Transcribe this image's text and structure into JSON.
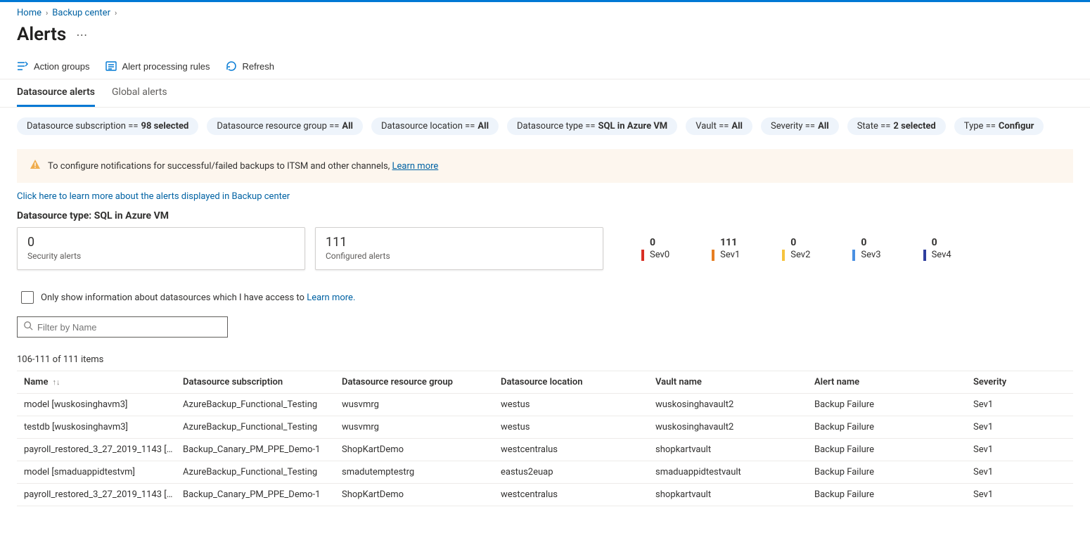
{
  "breadcrumb": {
    "home": "Home",
    "center": "Backup center"
  },
  "title": "Alerts",
  "toolbar": {
    "action_groups": "Action groups",
    "alert_rules": "Alert processing rules",
    "refresh": "Refresh"
  },
  "tabs": {
    "datasource": "Datasource alerts",
    "global": "Global alerts"
  },
  "filters": [
    {
      "label": "Datasource subscription == ",
      "value": "98 selected"
    },
    {
      "label": "Datasource resource group == ",
      "value": "All"
    },
    {
      "label": "Datasource location == ",
      "value": "All"
    },
    {
      "label": "Datasource type == ",
      "value": "SQL in Azure VM"
    },
    {
      "label": "Vault == ",
      "value": "All"
    },
    {
      "label": "Severity == ",
      "value": "All"
    },
    {
      "label": "State == ",
      "value": "2 selected"
    },
    {
      "label": "Type == ",
      "value": "Configur"
    }
  ],
  "banner": {
    "text": "To configure notifications for successful/failed backups to ITSM and other channels, ",
    "link": "Learn more"
  },
  "info_link": "Click here to learn more about the alerts displayed in Backup center",
  "section_label": "Datasource type: SQL in Azure VM",
  "cards": {
    "security": {
      "num": "0",
      "label": "Security alerts"
    },
    "configured": {
      "num": "111",
      "label": "Configured alerts"
    }
  },
  "severities": [
    {
      "num": "0",
      "label": "Sev0",
      "color": "#d93025"
    },
    {
      "num": "111",
      "label": "Sev1",
      "color": "#e67e22"
    },
    {
      "num": "0",
      "label": "Sev2",
      "color": "#f6c33d"
    },
    {
      "num": "0",
      "label": "Sev3",
      "color": "#4a90e2"
    },
    {
      "num": "0",
      "label": "Sev4",
      "color": "#2f3e9e"
    }
  ],
  "cb_line": {
    "text": "Only show information about datasources which I have access to ",
    "link": "Learn more."
  },
  "filter_placeholder": "Filter by Name",
  "count_text": "106-111 of 111 items",
  "columns": [
    "Name",
    "Datasource subscription",
    "Datasource resource group",
    "Datasource location",
    "Vault name",
    "Alert name",
    "Severity"
  ],
  "rows": [
    {
      "name": "model [wuskosinghavm3]",
      "sub": "AzureBackup_Functional_Testing",
      "rg": "wusvmrg",
      "loc": "westus",
      "vault": "wuskosinghavault2",
      "alert": "Backup Failure",
      "sev": "Sev1"
    },
    {
      "name": "testdb [wuskosinghavm3]",
      "sub": "AzureBackup_Functional_Testing",
      "rg": "wusvmrg",
      "loc": "westus",
      "vault": "wuskosinghavault2",
      "alert": "Backup Failure",
      "sev": "Sev1"
    },
    {
      "name": "payroll_restored_3_27_2019_1143 [s...",
      "sub": "Backup_Canary_PM_PPE_Demo-1",
      "rg": "ShopKartDemo",
      "loc": "westcentralus",
      "vault": "shopkartvault",
      "alert": "Backup Failure",
      "sev": "Sev1"
    },
    {
      "name": "model [smaduappidtestvm]",
      "sub": "AzureBackup_Functional_Testing",
      "rg": "smadutemptestrg",
      "loc": "eastus2euap",
      "vault": "smaduappidtestvault",
      "alert": "Backup Failure",
      "sev": "Sev1"
    },
    {
      "name": "payroll_restored_3_27_2019_1143 [s...",
      "sub": "Backup_Canary_PM_PPE_Demo-1",
      "rg": "ShopKartDemo",
      "loc": "westcentralus",
      "vault": "shopkartvault",
      "alert": "Backup Failure",
      "sev": "Sev1"
    }
  ]
}
